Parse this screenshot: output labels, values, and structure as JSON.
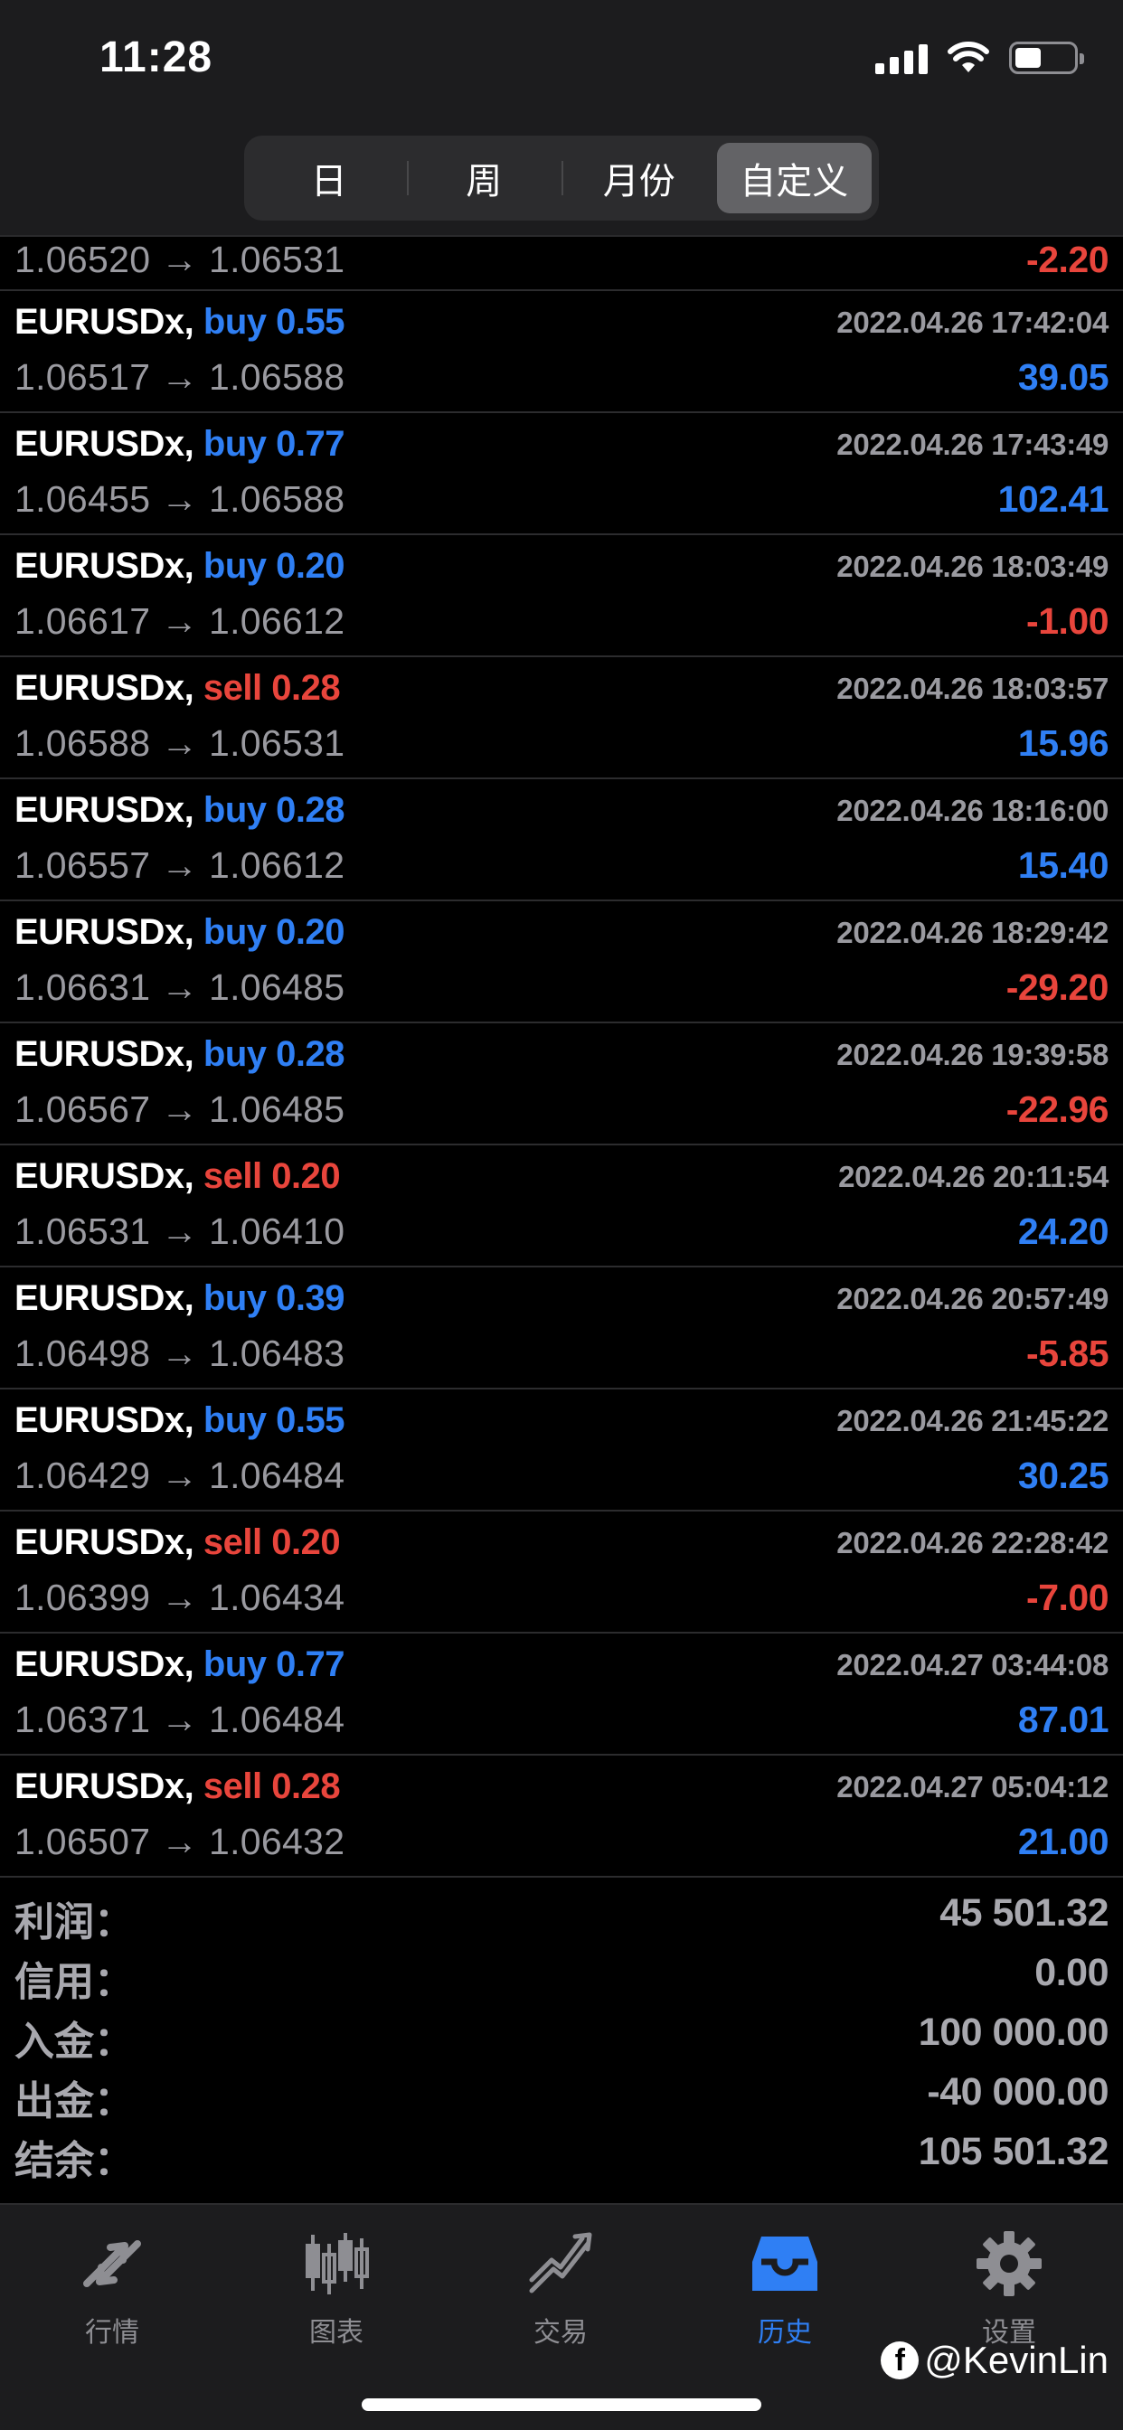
{
  "status_bar": {
    "time": "11:28"
  },
  "segments": [
    {
      "label": "日",
      "active": false
    },
    {
      "label": "周",
      "active": false
    },
    {
      "label": "月份",
      "active": false
    },
    {
      "label": "自定义",
      "active": true
    }
  ],
  "partial_row": {
    "prices": "1.06520 → 1.06531",
    "profit": "-2.20"
  },
  "trades": [
    {
      "symbol": "EURUSDx,",
      "side": "buy 0.55",
      "side_type": "buy",
      "time": "2022.04.26 17:42:04",
      "prices": "1.06517 → 1.06588",
      "profit": "39.05"
    },
    {
      "symbol": "EURUSDx,",
      "side": "buy 0.77",
      "side_type": "buy",
      "time": "2022.04.26 17:43:49",
      "prices": "1.06455 → 1.06588",
      "profit": "102.41"
    },
    {
      "symbol": "EURUSDx,",
      "side": "buy 0.20",
      "side_type": "buy",
      "time": "2022.04.26 18:03:49",
      "prices": "1.06617 → 1.06612",
      "profit": "-1.00"
    },
    {
      "symbol": "EURUSDx,",
      "side": "sell 0.28",
      "side_type": "sell",
      "time": "2022.04.26 18:03:57",
      "prices": "1.06588 → 1.06531",
      "profit": "15.96"
    },
    {
      "symbol": "EURUSDx,",
      "side": "buy 0.28",
      "side_type": "buy",
      "time": "2022.04.26 18:16:00",
      "prices": "1.06557 → 1.06612",
      "profit": "15.40"
    },
    {
      "symbol": "EURUSDx,",
      "side": "buy 0.20",
      "side_type": "buy",
      "time": "2022.04.26 18:29:42",
      "prices": "1.06631 → 1.06485",
      "profit": "-29.20"
    },
    {
      "symbol": "EURUSDx,",
      "side": "buy 0.28",
      "side_type": "buy",
      "time": "2022.04.26 19:39:58",
      "prices": "1.06567 → 1.06485",
      "profit": "-22.96"
    },
    {
      "symbol": "EURUSDx,",
      "side": "sell 0.20",
      "side_type": "sell",
      "time": "2022.04.26 20:11:54",
      "prices": "1.06531 → 1.06410",
      "profit": "24.20"
    },
    {
      "symbol": "EURUSDx,",
      "side": "buy 0.39",
      "side_type": "buy",
      "time": "2022.04.26 20:57:49",
      "prices": "1.06498 → 1.06483",
      "profit": "-5.85"
    },
    {
      "symbol": "EURUSDx,",
      "side": "buy 0.55",
      "side_type": "buy",
      "time": "2022.04.26 21:45:22",
      "prices": "1.06429 → 1.06484",
      "profit": "30.25"
    },
    {
      "symbol": "EURUSDx,",
      "side": "sell 0.20",
      "side_type": "sell",
      "time": "2022.04.26 22:28:42",
      "prices": "1.06399 → 1.06434",
      "profit": "-7.00"
    },
    {
      "symbol": "EURUSDx,",
      "side": "buy 0.77",
      "side_type": "buy",
      "time": "2022.04.27 03:44:08",
      "prices": "1.06371 → 1.06484",
      "profit": "87.01"
    },
    {
      "symbol": "EURUSDx,",
      "side": "sell 0.28",
      "side_type": "sell",
      "time": "2022.04.27 05:04:12",
      "prices": "1.06507 → 1.06432",
      "profit": "21.00"
    }
  ],
  "summary": [
    {
      "label": "利润：",
      "value": "45 501.32"
    },
    {
      "label": "信用：",
      "value": "0.00"
    },
    {
      "label": "入金：",
      "value": "100 000.00"
    },
    {
      "label": "出金：",
      "value": "-40 000.00"
    },
    {
      "label": "结余：",
      "value": "105 501.32"
    }
  ],
  "tabs": [
    {
      "label": "行情",
      "icon": "quotes-icon",
      "active": false
    },
    {
      "label": "图表",
      "icon": "chart-icon",
      "active": false
    },
    {
      "label": "交易",
      "icon": "trade-icon",
      "active": false
    },
    {
      "label": "历史",
      "icon": "history-icon",
      "active": true
    },
    {
      "label": "设置",
      "icon": "settings-icon",
      "active": false
    }
  ],
  "watermark": {
    "text": "@KevinLin",
    "icon": "facebook-icon"
  },
  "colors": {
    "buy": "#2f7ff4",
    "sell": "#e8453c",
    "active_tab": "#2f7ff4",
    "inactive_tab": "#8e8e93"
  }
}
